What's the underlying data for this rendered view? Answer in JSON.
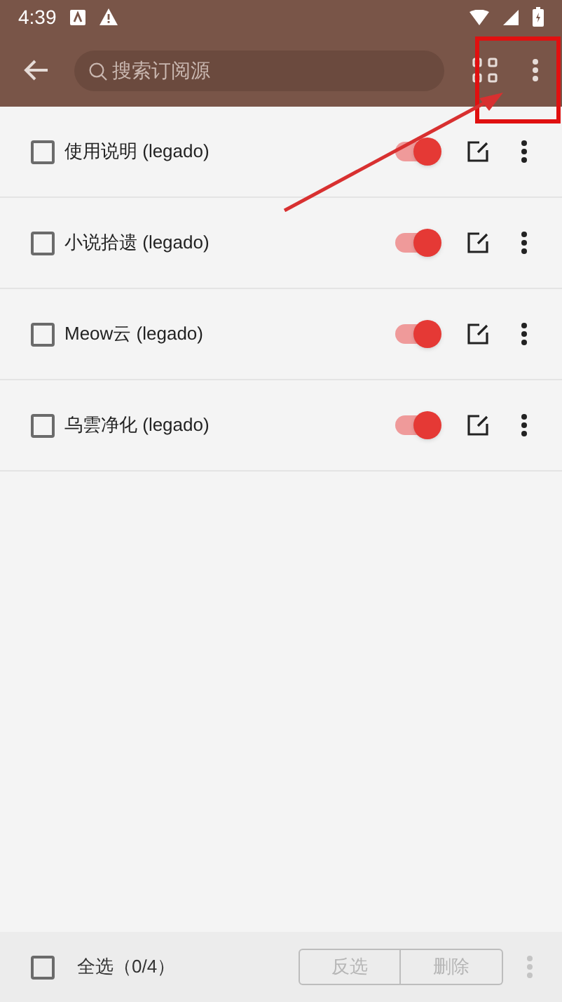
{
  "status_bar": {
    "time": "4:39"
  },
  "toolbar": {
    "search": {
      "placeholder": "搜索订阅源"
    }
  },
  "sources": [
    {
      "name": "使用说明 (legado)",
      "checked": false,
      "on": true
    },
    {
      "name": "小说拾遗 (legado)",
      "checked": false,
      "on": true
    },
    {
      "name": "Meow云 (legado)",
      "checked": false,
      "on": true
    },
    {
      "name": "乌雲净化 (legado)",
      "checked": false,
      "on": true
    }
  ],
  "bottom_bar": {
    "select_all": {
      "label": "全选（0/4）",
      "checked": false
    },
    "buttons": [
      {
        "label": "反选",
        "disabled": true
      },
      {
        "label": "删除",
        "disabled": true
      }
    ]
  },
  "annotation": {
    "kind": "highlight"
  }
}
